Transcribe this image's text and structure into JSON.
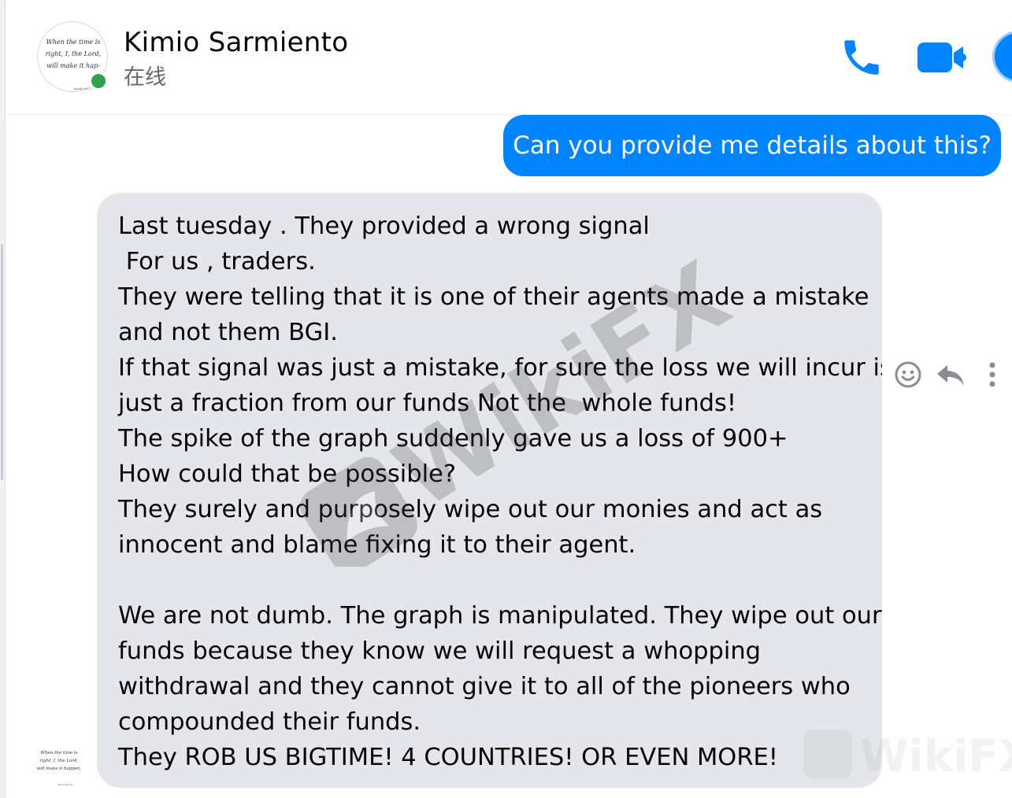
{
  "header": {
    "contact_name": "Kimio Sarmiento",
    "status": "在线",
    "call_icon": "phone-icon",
    "video_icon": "video-camera-icon",
    "info_icon": "info-icon",
    "accent_color": "#0084ff",
    "online_color": "#31a24c"
  },
  "thread": {
    "outgoing_message": "Can you provide me details about this?",
    "incoming_lines": [
      "Last tuesday . They provided a wrong signal",
      " For us , traders.",
      "They were telling that it is one of their agents made a mistake",
      "and not them BGI.",
      "If that signal was just a mistake, for sure the loss we will incur is",
      "just a fraction from our funds Not the  whole funds!",
      "The spike of the graph suddenly gave us a loss of 900+",
      "How could that be possible?",
      "They surely and purposely wipe out our monies and act as",
      "innocent and blame fixing it to their agent.",
      "",
      "We are not dumb. The graph is manipulated. They wipe out our",
      "funds because they know we will request a whopping",
      "withdrawal and they cannot give it to all of the pioneers who",
      "compounded their funds.",
      "They ROB US BIGTIME! 4 COUNTRIES! OR EVEN MORE!"
    ],
    "message_actions": [
      "smiley-react-icon",
      "reply-arrow-icon",
      "more-dots-icon"
    ]
  },
  "watermark": {
    "text": "WikiFX"
  }
}
